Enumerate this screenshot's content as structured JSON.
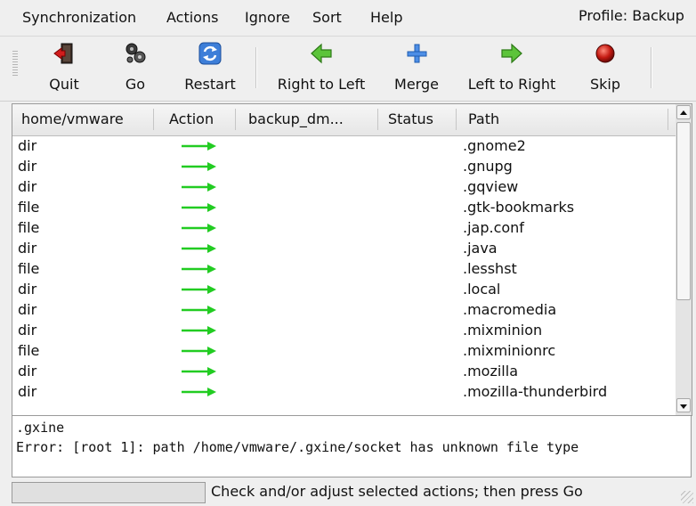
{
  "menubar": {
    "items": [
      "Synchronization",
      "Actions",
      "Ignore",
      "Sort",
      "Help"
    ],
    "profile": "Profile: Backup"
  },
  "toolbar": {
    "buttons": [
      {
        "label": "Quit",
        "icon": "exit-door-icon"
      },
      {
        "label": "Go",
        "icon": "gears-icon"
      },
      {
        "label": "Restart",
        "icon": "refresh-icon"
      },
      {
        "label": "Right to Left",
        "icon": "green-arrow-left-icon"
      },
      {
        "label": "Merge",
        "icon": "blue-plus-icon"
      },
      {
        "label": "Left to Right",
        "icon": "green-arrow-right-icon"
      },
      {
        "label": "Skip",
        "icon": "red-ball-icon"
      }
    ]
  },
  "table": {
    "columns": [
      "home/vmware",
      "Action",
      "backup_dm...",
      "Status",
      "Path"
    ],
    "rows": [
      {
        "type": "dir",
        "action": "left-to-right",
        "path": ".gnome2"
      },
      {
        "type": "dir",
        "action": "left-to-right",
        "path": ".gnupg"
      },
      {
        "type": "dir",
        "action": "left-to-right",
        "path": ".gqview"
      },
      {
        "type": "file",
        "action": "left-to-right",
        "path": ".gtk-bookmarks"
      },
      {
        "type": "file",
        "action": "left-to-right",
        "path": ".jap.conf"
      },
      {
        "type": "dir",
        "action": "left-to-right",
        "path": ".java"
      },
      {
        "type": "file",
        "action": "left-to-right",
        "path": ".lesshst"
      },
      {
        "type": "dir",
        "action": "left-to-right",
        "path": ".local"
      },
      {
        "type": "dir",
        "action": "left-to-right",
        "path": ".macromedia"
      },
      {
        "type": "dir",
        "action": "left-to-right",
        "path": ".mixminion"
      },
      {
        "type": "file",
        "action": "left-to-right",
        "path": ".mixminionrc"
      },
      {
        "type": "dir",
        "action": "left-to-right",
        "path": ".mozilla"
      },
      {
        "type": "dir",
        "action": "left-to-right",
        "path": ".mozilla-thunderbird"
      }
    ],
    "arrow_color": "#22cc22"
  },
  "details": {
    "line1": ".gxine",
    "line2": "Error: [root 1]: path /home/vmware/.gxine/socket has unknown file type"
  },
  "status": {
    "message": "Check and/or adjust selected actions; then press Go"
  }
}
